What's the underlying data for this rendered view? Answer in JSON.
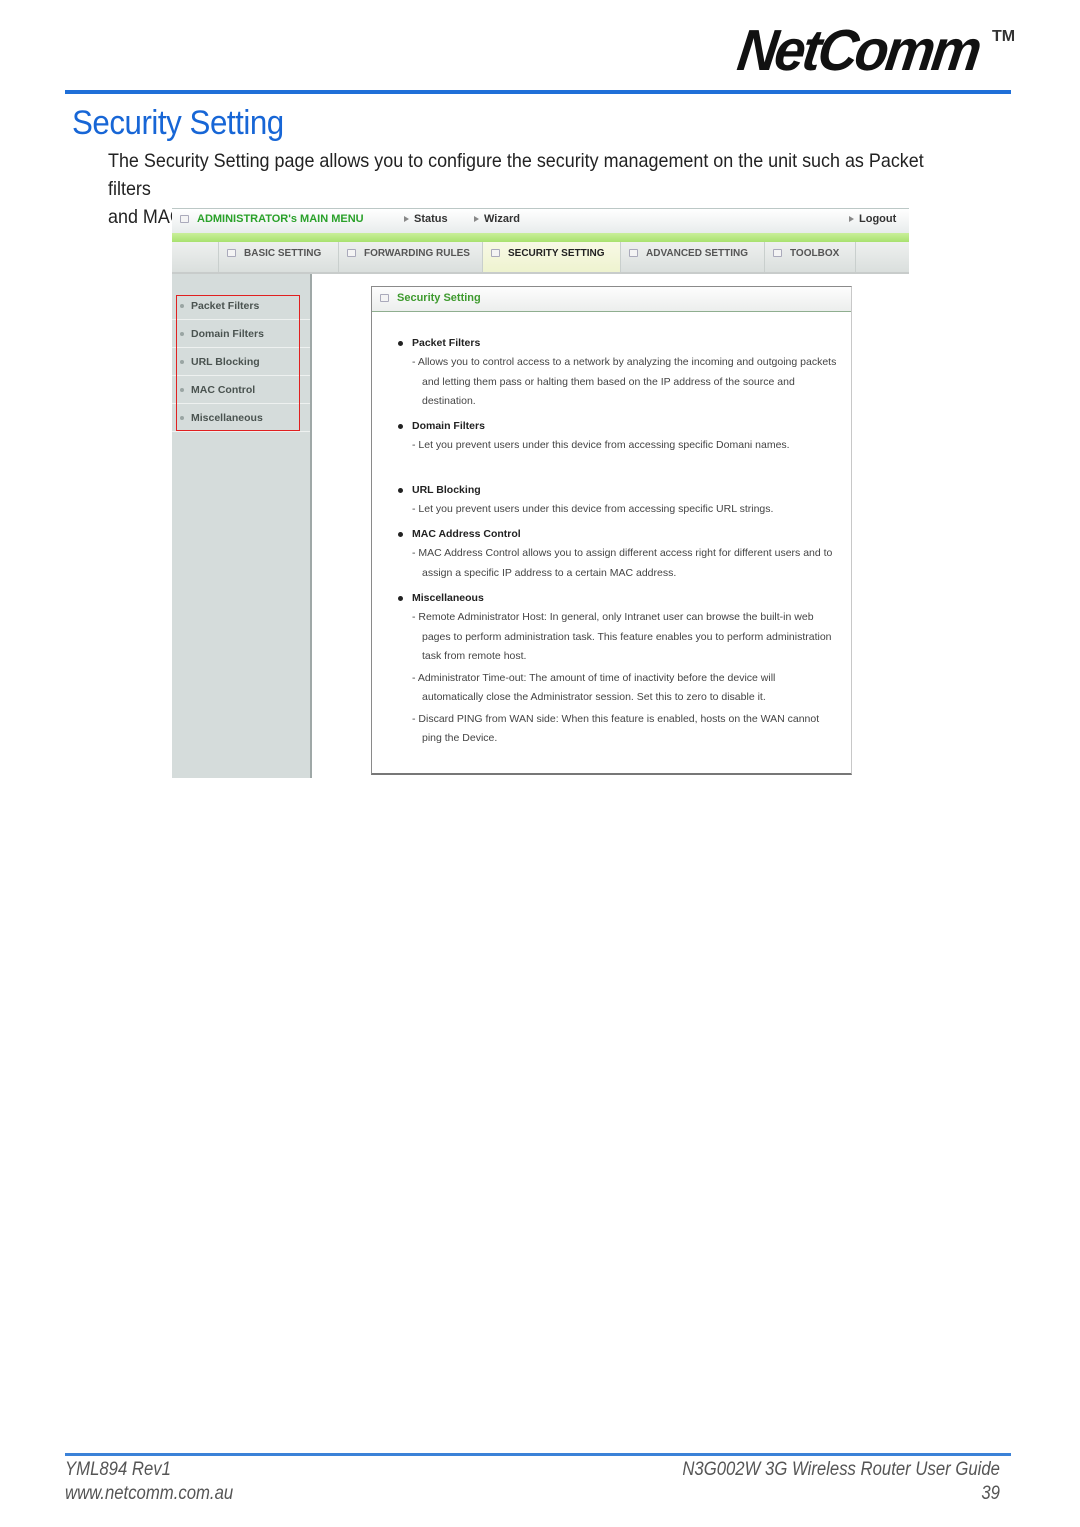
{
  "brand": {
    "logo_text": "NetComm",
    "trademark": "TM",
    "accent_color": "#1766d6"
  },
  "page": {
    "title": "Security Setting",
    "intro": [
      "The Security Setting page allows you to configure the security management on the unit such as Packet filters",
      "and MAC Control. Click on any of the menu on the left to access the respective setting page."
    ]
  },
  "router_ui": {
    "topbar": {
      "main_menu": "ADMINISTRATOR's MAIN MENU",
      "status": "Status",
      "wizard": "Wizard",
      "logout": "Logout"
    },
    "tabs": [
      {
        "label": "BASIC SETTING",
        "active": false
      },
      {
        "label": "FORWARDING RULES",
        "active": false
      },
      {
        "label": "SECURITY SETTING",
        "active": true
      },
      {
        "label": "ADVANCED SETTING",
        "active": false
      },
      {
        "label": "TOOLBOX",
        "active": false
      }
    ],
    "sidebar": {
      "items": [
        {
          "label": "Packet Filters"
        },
        {
          "label": "Domain Filters"
        },
        {
          "label": "URL Blocking"
        },
        {
          "label": "MAC Control"
        },
        {
          "label": "Miscellaneous"
        }
      ],
      "highlight_color": "#e02020"
    },
    "panel": {
      "title": "Security Setting",
      "sections": [
        {
          "title": "Packet Filters",
          "desc": [
            "- Allows you to control access to a network by analyzing the incoming and outgoing packets and letting them pass or halting them based on the IP address of the source and destination."
          ]
        },
        {
          "title": "Domain Filters",
          "desc": [
            "- Let you prevent users under this device from accessing specific Domani names."
          ]
        },
        {
          "title": "URL Blocking",
          "desc": [
            "- Let you prevent users under this device from accessing specific URL strings."
          ]
        },
        {
          "title": "MAC Address Control",
          "desc": [
            "- MAC Address Control allows you to assign different access right for different users and to assign a specific IP address to a certain MAC address."
          ]
        },
        {
          "title": "Miscellaneous",
          "desc": [
            "- Remote Administrator Host: In general, only Intranet user can browse the built-in web pages to perform administration task. This feature enables you to perform administration task from remote host.",
            "- Administrator Time-out: The amount of time of inactivity before the device will automatically close the Administrator session. Set this to zero to disable it.",
            "- Discard PING from WAN side: When this feature is enabled, hosts on the WAN cannot ping the Device."
          ]
        }
      ]
    }
  },
  "footer": {
    "doc_id": "YML894 Rev1",
    "website": "www.netcomm.com.au",
    "guide_title": "N3G002W 3G Wireless Router User Guide",
    "page_number": "39"
  }
}
